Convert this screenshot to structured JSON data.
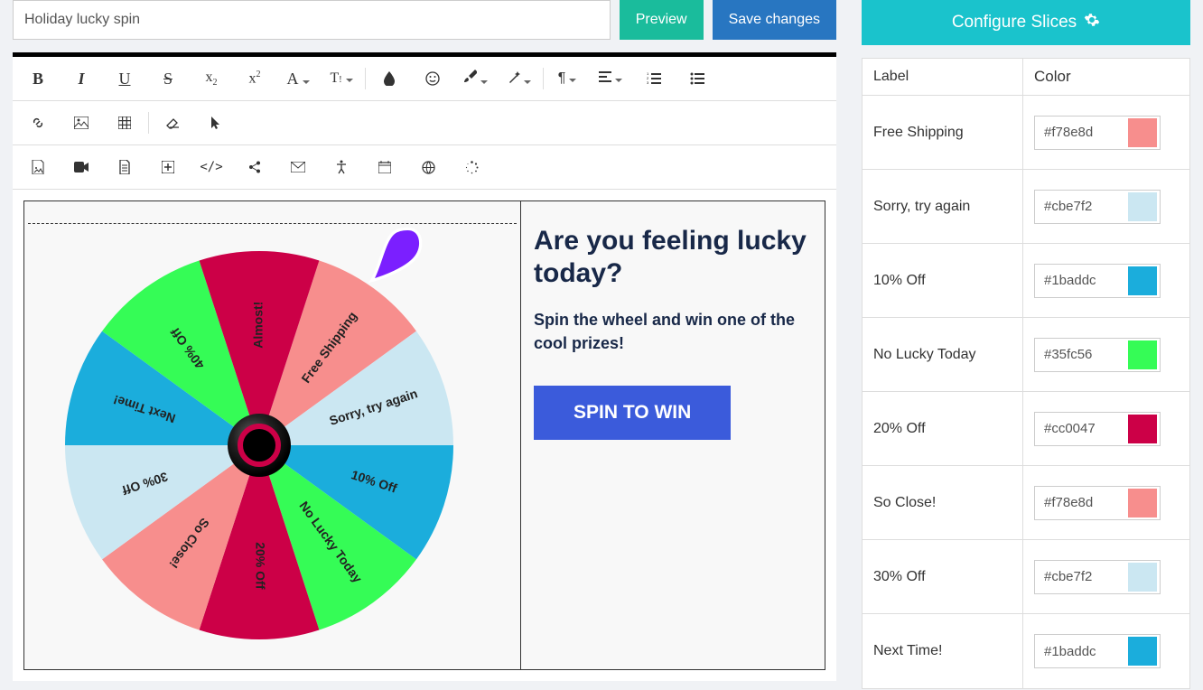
{
  "header": {
    "title_value": "Holiday lucky spin",
    "preview": "Preview",
    "save": "Save changes"
  },
  "canvas": {
    "headline": "Are you feeling lucky today?",
    "subline": "Spin the wheel and win one of the cool prizes!",
    "spin_label": "SPIN TO WIN"
  },
  "config": {
    "header": "Configure Slices",
    "col_label": "Label",
    "col_color": "Color"
  },
  "slices": [
    {
      "label": "Free Shipping",
      "color": "#f78e8d"
    },
    {
      "label": "Sorry, try again",
      "color": "#cbe7f2"
    },
    {
      "label": "10% Off",
      "color": "#1baddc"
    },
    {
      "label": "No Lucky Today",
      "color": "#35fc56"
    },
    {
      "label": "20% Off",
      "color": "#cc0047"
    },
    {
      "label": "So Close!",
      "color": "#f78e8d"
    },
    {
      "label": "30% Off",
      "color": "#cbe7f2"
    },
    {
      "label": "Next Time!",
      "color": "#1baddc"
    }
  ],
  "wheel_extra": [
    {
      "label": "40% Off",
      "color": "#35fc56"
    },
    {
      "label": "Almost!",
      "color": "#cc0047"
    }
  ],
  "colors": {
    "accent_teal": "#1ac3cc",
    "btn_green": "#1abc9c",
    "btn_blue": "#2876c1",
    "spin_blue": "#3b5bdb",
    "pointer": "#7b1fff"
  },
  "toolbar_icons": [
    "bold",
    "italic",
    "underline",
    "strikethrough",
    "subscript",
    "superscript",
    "font-family",
    "font-size",
    "sep",
    "tint",
    "smile",
    "brush",
    "magic",
    "sep",
    "paragraph",
    "align",
    "list-ol",
    "list-ul"
  ],
  "toolbar_icons2": [
    "link",
    "image",
    "table",
    "sep",
    "eraser",
    "cursor"
  ],
  "toolbar_icons3": [
    "file-image",
    "video",
    "file",
    "plus-square",
    "code",
    "share",
    "envelope",
    "accessibility",
    "calendar",
    "globe",
    "spinner"
  ]
}
